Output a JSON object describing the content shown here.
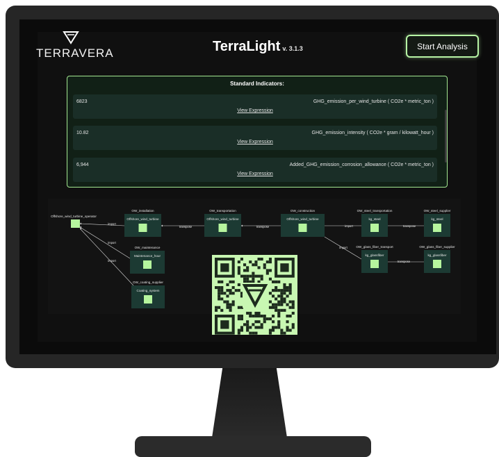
{
  "brand": {
    "name": "TERRAVERA"
  },
  "app": {
    "title": "TerraLight",
    "version": "v. 3.1.3"
  },
  "header": {
    "start_button": "Start Analysis"
  },
  "indicators": {
    "heading": "Standard Indicators:",
    "rows": [
      {
        "value": "6823",
        "name": "GHG_emission_per_wind_turbine ( CO2e * metric_ton )",
        "link": "View Expression"
      },
      {
        "value": "10.82",
        "name": "GHG_emission_intensity ( CO2e * gram / kilowatt_hour )",
        "link": "View Expression"
      },
      {
        "value": "6,944",
        "name": "Added_GHG_emission_corrosion_allowance ( CO2e * metric_ton )",
        "link": "View Expression"
      }
    ]
  },
  "diagram": {
    "operator": "Offshore_wind_turbine_operator",
    "nodes": [
      {
        "group": "OW_installation",
        "label": "Offshore_wind_turbine"
      },
      {
        "group": "OW_transportation",
        "label": "Offshore_wind_turbine"
      },
      {
        "group": "OW_construction",
        "label": "Offshore_wind_turbine"
      },
      {
        "group": "OW_steel_transportation",
        "label": "kg_steel"
      },
      {
        "group": "OW_steel_supplier",
        "label": "kg_steel"
      },
      {
        "group": "OW_glass_fiber_transport",
        "label": "kg_glassfiber"
      },
      {
        "group": "OW_glass_fiber_supplier",
        "label": "kg_glassfiber"
      },
      {
        "group": "OW_maintenance",
        "label": "Maintenance_hour"
      },
      {
        "group": "OW_coating_supplier",
        "label": "Coating_system"
      }
    ],
    "edge_labels": [
      "import",
      "transpose",
      "transpose",
      "import",
      "transpose",
      "import",
      "transpose",
      "import",
      "import"
    ]
  },
  "colors": {
    "accent": "#b7f5a5",
    "node": "#b6f59e",
    "panel": "#112016",
    "row": "#1a2e27",
    "qr": "#c8f7b2"
  },
  "icons": {
    "brand_mark": "v-triangle-logo",
    "qr": "qr-code"
  }
}
